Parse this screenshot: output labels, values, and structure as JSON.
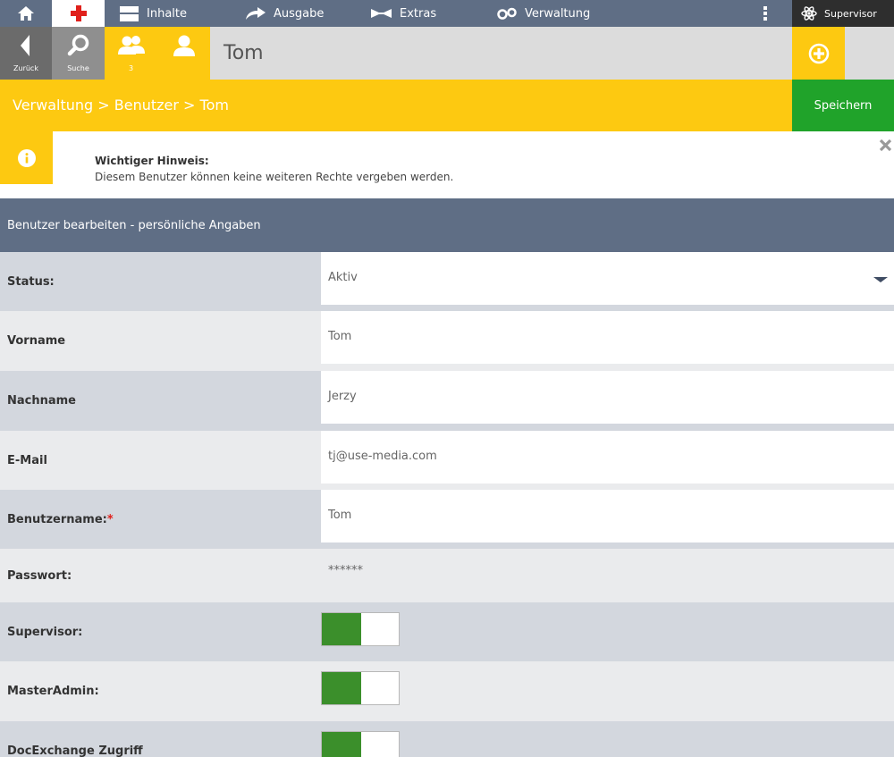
{
  "topnav": {
    "items": [
      {
        "label": "Inhalte",
        "icon": "layout-icon"
      },
      {
        "label": "Ausgabe",
        "icon": "share-arrow-icon"
      },
      {
        "label": "Extras",
        "icon": "extras-icon"
      },
      {
        "label": "Verwaltung",
        "icon": "gears-icon"
      }
    ],
    "supervisor_label": "Supervisor"
  },
  "toolbar": {
    "back_label": "Zurück",
    "search_label": "Suche",
    "users_count": "3",
    "title": "Tom"
  },
  "breadcrumb": "Verwaltung > Benutzer > Tom",
  "save_label": "Speichern",
  "notice": {
    "title": "Wichtiger Hinweis:",
    "text": "Diesem Benutzer können keine weiteren Rechte vergeben werden."
  },
  "section_title": "Benutzer bearbeiten - persönliche Angaben",
  "form": {
    "status": {
      "label": "Status:",
      "value": "Aktiv"
    },
    "vorname": {
      "label": "Vorname",
      "value": "Tom"
    },
    "nachname": {
      "label": "Nachname",
      "value": "Jerzy"
    },
    "email": {
      "label": "E-Mail",
      "value": "tj@use-media.com"
    },
    "username": {
      "label": "Benutzername:",
      "required_mark": "*",
      "value": "Tom"
    },
    "password": {
      "label": "Passwort:",
      "value": "******"
    },
    "supervisor": {
      "label": "Supervisor:",
      "enabled": true
    },
    "masteradmin": {
      "label": "MasterAdmin:",
      "enabled": true
    },
    "docexchange": {
      "label": "DocExchange Zugriff",
      "enabled": true
    }
  },
  "colors": {
    "accent_yellow": "#fdc911",
    "nav_slate": "#5f6e85",
    "save_green": "#20a32a",
    "toggle_green": "#3b8f2b",
    "required_red": "#e0201b"
  }
}
